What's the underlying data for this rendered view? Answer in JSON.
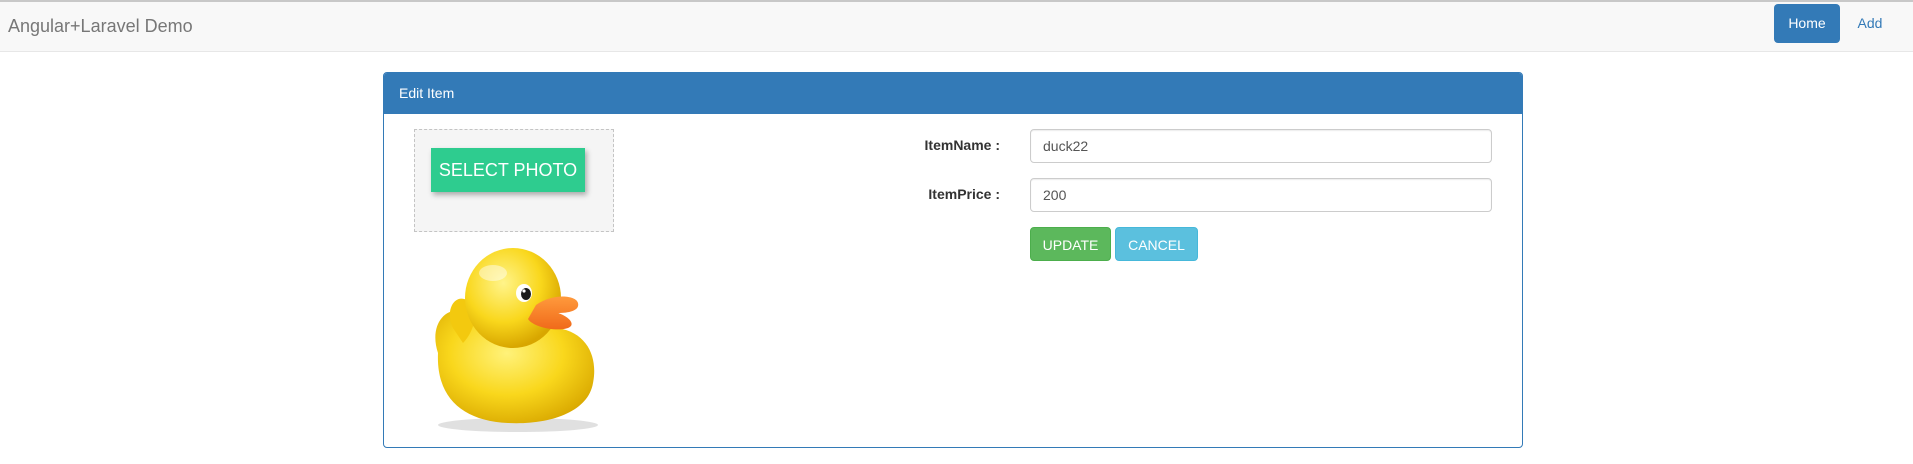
{
  "navbar": {
    "brand": "Angular+Laravel Demo",
    "items": [
      {
        "label": "Home",
        "active": true
      },
      {
        "label": "Add",
        "active": false
      }
    ]
  },
  "panel": {
    "title": "Edit Item",
    "photo": {
      "button_label": "SELECT PHOTO",
      "image_icon": "rubber-duck-image"
    },
    "form": {
      "name_label": "ItemName :",
      "name_value": "duck22",
      "price_label": "ItemPrice :",
      "price_value": "200",
      "update_label": "UPDATE",
      "cancel_label": "CANCEL"
    }
  },
  "colors": {
    "primary": "#337ab7",
    "select_photo": "#2ecc8f",
    "update": "#5cb85c",
    "cancel": "#5bc0de"
  }
}
